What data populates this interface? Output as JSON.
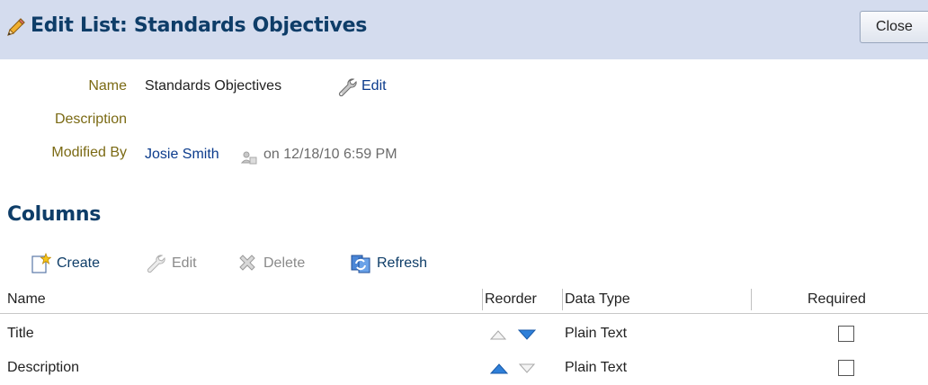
{
  "header": {
    "title": "Edit List: Standards Objectives",
    "close_label": "Close"
  },
  "properties": {
    "name_label": "Name",
    "name_value": "Standards Objectives",
    "edit_label": "Edit",
    "description_label": "Description",
    "description_value": "",
    "modified_label": "Modified By",
    "modified_user": "Josie Smith",
    "modified_on": "on 12/18/10 6:59 PM"
  },
  "columns_section": {
    "title": "Columns",
    "toolbar": {
      "create": "Create",
      "edit": "Edit",
      "delete": "Delete",
      "refresh": "Refresh"
    },
    "headers": {
      "name": "Name",
      "reorder": "Reorder",
      "data_type": "Data Type",
      "required": "Required"
    },
    "rows": [
      {
        "name": "Title",
        "data_type": "Plain Text",
        "required": false
      },
      {
        "name": "Description",
        "data_type": "Plain Text",
        "required": false
      }
    ]
  },
  "colors": {
    "header_bg": "#d4dcee",
    "title_color": "#0e3d68",
    "label_color": "#7b6a14",
    "link_color": "#0b3b8c",
    "arrow_blue": "#2e7fd8"
  },
  "icons": [
    "pencil-icon",
    "wrench-icon",
    "user-status-icon",
    "create-icon",
    "edit-icon",
    "delete-icon",
    "refresh-icon",
    "move-up-icon",
    "move-down-icon"
  ]
}
